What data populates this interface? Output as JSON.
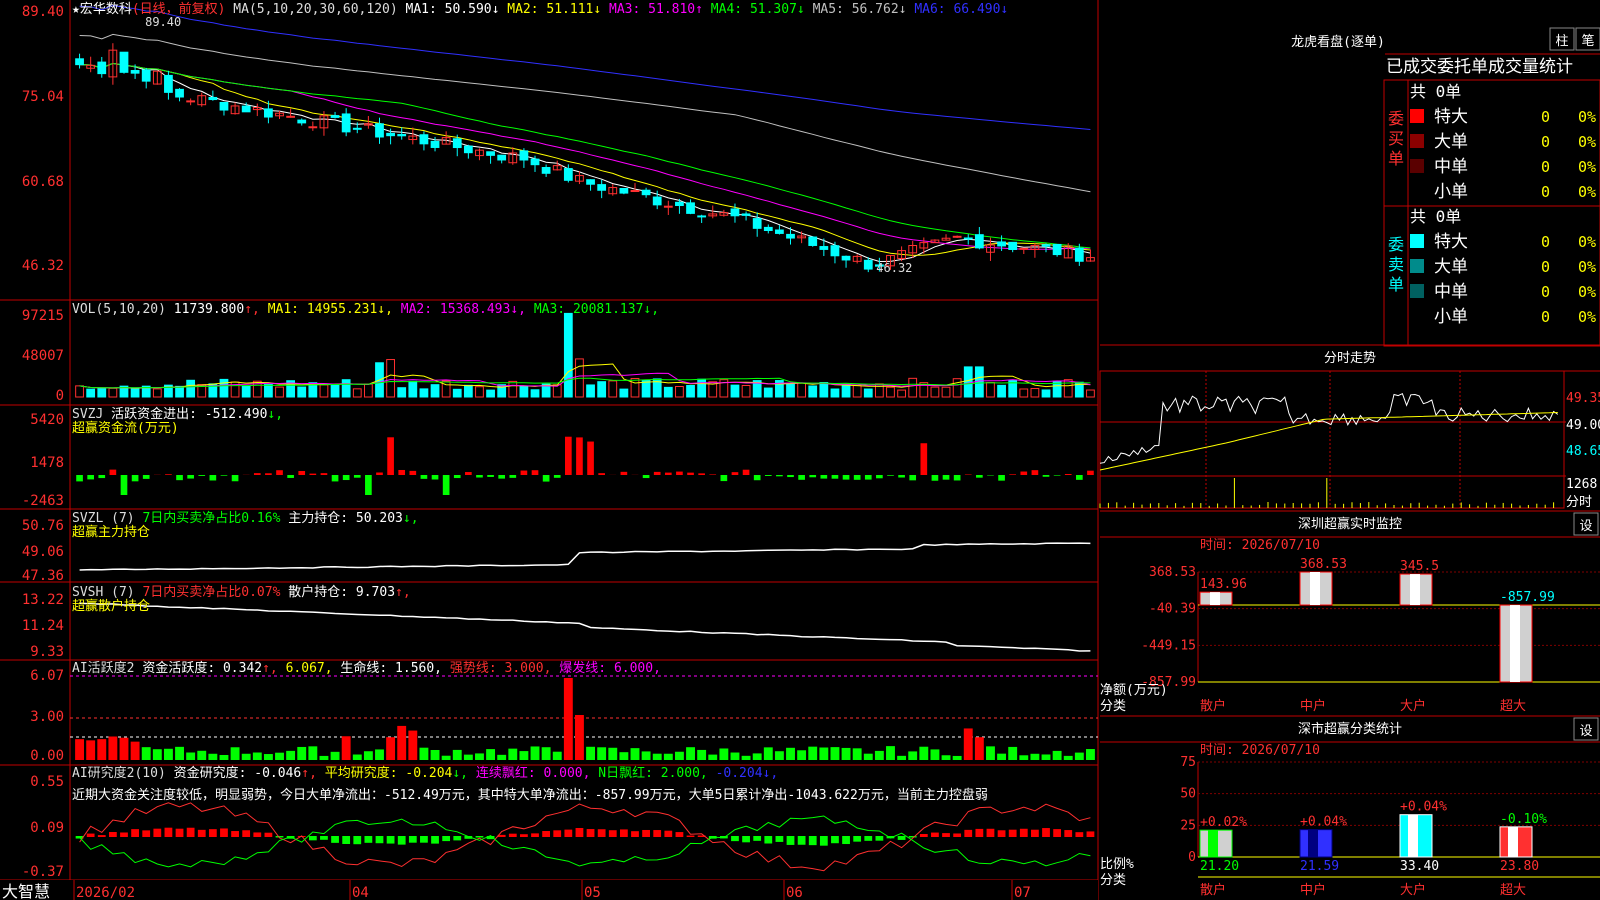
{
  "stock_title": "★宏华数科",
  "chart_mode": "(日线，前复权)",
  "ma_header": "MA(5,10,20,30,60,120)",
  "ma_values": [
    {
      "label": "MA1:",
      "value": "50.590",
      "arrow": "↓",
      "color": "#ffffff"
    },
    {
      "label": "MA2:",
      "value": "51.111",
      "arrow": "↓",
      "color": "#ffff00"
    },
    {
      "label": "MA3:",
      "value": "51.810",
      "arrow": "↑",
      "color": "#ff00ff"
    },
    {
      "label": "MA4:",
      "value": "51.307",
      "arrow": "↓",
      "color": "#00ff00"
    },
    {
      "label": "MA5:",
      "value": "56.762",
      "arrow": "↓",
      "color": "#c0c0c0"
    },
    {
      "label": "MA6:",
      "value": "66.490",
      "arrow": "↓",
      "color": "#3030ff"
    }
  ],
  "price_high_label": "89.40",
  "price_low_label": "46.32",
  "vol_header": {
    "name": "VOL(5,10,20)",
    "value": "11739.800",
    "arrow": "↑",
    "ma": [
      {
        "label": "MA1:",
        "value": "14955.231",
        "arrow": "↓",
        "color": "#ffff00"
      },
      {
        "label": "MA2:",
        "value": "15368.493",
        "arrow": "↓",
        "color": "#ff00ff"
      },
      {
        "label": "MA3:",
        "value": "20081.137",
        "arrow": "↓",
        "color": "#00ff00"
      }
    ]
  },
  "svzj_header": {
    "name": "SVZJ",
    "label": "活跃资金进出:",
    "value": "-512.490",
    "arrow": "↓",
    "sub": "超赢资金流(万元)"
  },
  "svzl_header": {
    "name": "SVZL (7)",
    "label": "7日内买卖净占比",
    "pct": "0.16%",
    "label2": "主力持仓:",
    "value": "50.203",
    "arrow": "↓",
    "sub": "超赢主力持仓"
  },
  "svsh_header": {
    "name": "SVSH (7)",
    "label": "7日内买卖净占比",
    "pct": "0.07%",
    "label2": "散户持仓:",
    "value": "9.703",
    "arrow": "↑",
    "sub": "超赢散户持仓"
  },
  "ai_header": {
    "name": "AI活跃度2",
    "label": "资金活跃度:",
    "value": "0.342",
    "arrow": "↑",
    "v2": "6.067",
    "label3": "生命线:",
    "v3": "1.560",
    "label4": "强势线:",
    "v4": "3.000",
    "label5": "爆发线:",
    "v5": "6.000"
  },
  "research_header": {
    "name": "AI研究度2(10)",
    "label": "资金研究度:",
    "value": "-0.046",
    "arrow": "↑",
    "label2": "平均研究度:",
    "v2": "-0.204",
    "arrow2": "↓",
    "label3": "连续飘红:",
    "v3": "0.000",
    "label4": "N日飘红:",
    "v4": "2.000",
    "v5": "-0.204",
    "arrow5": "↓"
  },
  "research_comment": "近期大资金关注度较低，明显弱势，今日大单净流出：-512.49万元，其中特大单净流出：-857.99万元，大单5日累计净出-1043.622万元，当前主力控盘弱",
  "date_axis": [
    "2026/02",
    "04",
    "05",
    "06",
    "07"
  ],
  "brand": "大智慧",
  "y_axes": {
    "price": [
      "89.40",
      "75.04",
      "60.68",
      "46.32"
    ],
    "vol": [
      "97215",
      "48007",
      "0"
    ],
    "svzj": [
      "5420",
      "1478",
      "-2463"
    ],
    "svzl": [
      "50.76",
      "49.06",
      "47.36"
    ],
    "svsh": [
      "13.22",
      "11.24",
      "9.33"
    ],
    "ai": [
      "6.07",
      "3.00",
      "0.00"
    ],
    "research": [
      "0.55",
      "0.09",
      "-0.37"
    ]
  },
  "longhu": {
    "title": "龙虎看盘(逐单)",
    "buttons": [
      "柱",
      "笔"
    ],
    "subtitle": "已成交委托单成交量统计",
    "buy_label": "委买单",
    "sell_label": "委卖单",
    "buy_total": "共 0单",
    "sell_total": "共 0单",
    "buy_rows": [
      {
        "name": "特大",
        "count": "0",
        "pct": "0%",
        "color": "#ff0000"
      },
      {
        "name": "大单",
        "count": "0",
        "pct": "0%",
        "color": "#8b0000"
      },
      {
        "name": "中单",
        "count": "0",
        "pct": "0%",
        "color": "#5a0000"
      },
      {
        "name": "小单",
        "count": "0",
        "pct": "0%",
        "color": ""
      }
    ],
    "sell_rows": [
      {
        "name": "特大",
        "count": "0",
        "pct": "0%",
        "color": "#00ffff"
      },
      {
        "name": "大单",
        "count": "0",
        "pct": "0%",
        "color": "#008b8b"
      },
      {
        "name": "中单",
        "count": "0",
        "pct": "0%",
        "color": "#006060"
      },
      {
        "name": "小单",
        "count": "0",
        "pct": "0%",
        "color": ""
      }
    ]
  },
  "fenshi": {
    "title": "分时走势",
    "labels": [
      "49.35",
      "49.00",
      "48.65"
    ],
    "vol_label": "1268",
    "vol_unit": "分时"
  },
  "monitor": {
    "title": "深圳超赢实时监控",
    "button": "设",
    "time": "时间: 2026/07/10",
    "y_labels": [
      "368.53",
      "-40.39",
      "-449.15",
      "-857.99"
    ],
    "unit_label": "净额(万元)",
    "cat_label": "分类",
    "categories": [
      "散户",
      "中户",
      "大户",
      "超大"
    ],
    "values": [
      143.96,
      368.53,
      345.5,
      -857.99
    ],
    "value_labels": [
      "143.96",
      "368.53",
      "345.5",
      "-857.99"
    ]
  },
  "classify": {
    "title": "深市超赢分类统计",
    "button": "设",
    "time": "时间: 2026/07/10",
    "y_labels": [
      "75",
      "50",
      "25",
      "0"
    ],
    "ratio_label": "比例%",
    "cat_label": "分类",
    "categories": [
      "散户",
      "中户",
      "大户",
      "超大"
    ],
    "values": [
      21.2,
      21.59,
      33.4,
      23.8
    ],
    "value_labels": [
      "21.20",
      "21.59",
      "33.40",
      "23.80"
    ],
    "changes": [
      "+0.02%",
      "+0.04%",
      "+0.04%",
      "-0.10%"
    ]
  },
  "chart_data": {
    "type": "line",
    "title": "宏华数科 日线 前复权",
    "xlabel": "",
    "ylabel": "",
    "categories": [
      "2026/02",
      "04",
      "05",
      "06",
      "07"
    ],
    "ylim": [
      46.32,
      89.4
    ],
    "series": [
      {
        "name": "MA1",
        "values": [
          80,
          76,
          72,
          71,
          70,
          67,
          62,
          57,
          54,
          51,
          52,
          50.59
        ]
      },
      {
        "name": "MA6",
        "values": [
          79,
          78.5,
          78,
          77,
          76,
          75,
          73.5,
          72,
          70.5,
          69,
          67.5,
          66.49
        ]
      }
    ],
    "annotations": [
      "89.40",
      "46.32"
    ]
  }
}
